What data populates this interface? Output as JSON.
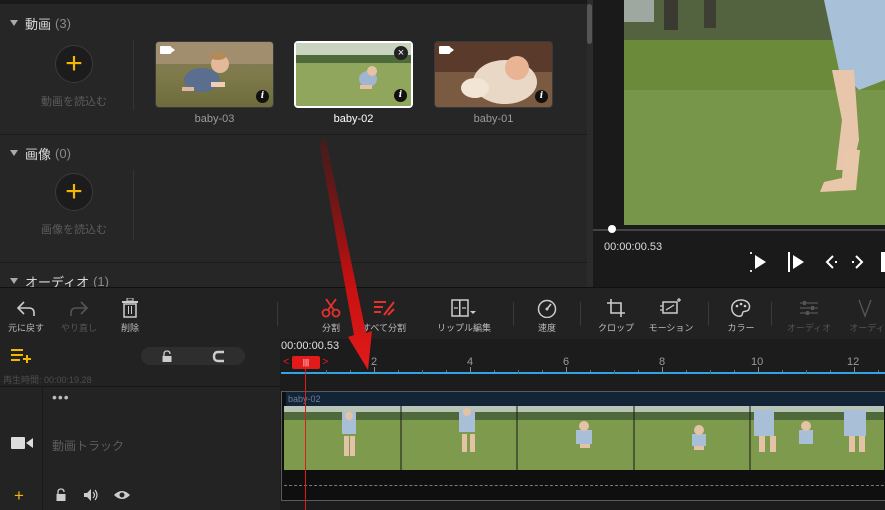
{
  "library": {
    "video_section": {
      "title": "動画",
      "count": "(3)",
      "import_label": "動画を読込む"
    },
    "image_section": {
      "title": "画像",
      "count": "(0)",
      "import_label": "画像を読込む"
    },
    "audio_section": {
      "title": "オーディオ",
      "count": "(1)"
    },
    "clips": [
      {
        "name": "baby-03",
        "selected": false
      },
      {
        "name": "baby-02",
        "selected": true
      },
      {
        "name": "baby-01",
        "selected": false
      }
    ]
  },
  "preview": {
    "time": "00:00:00.53",
    "progress": 0.06
  },
  "toolbar": {
    "undo": "元に戻す",
    "redo": "やり直し",
    "delete": "削除",
    "split": "分割",
    "split_all": "すべて分割",
    "ripple_edit": "リップル編集",
    "speed": "速度",
    "crop": "クロップ",
    "motion": "モーション",
    "color": "カラー",
    "audio": "オーディオ",
    "audio2": "オーディ"
  },
  "timeline": {
    "duration_label": "再生時間:",
    "duration": "00:00:19.28",
    "current_time": "00:00:00.53",
    "playhead_tag": "|||",
    "ruler_labels": [
      "2",
      "4",
      "6",
      "8",
      "10",
      "12"
    ],
    "track_more": "•••",
    "track_name": "動画トラック",
    "clip_name": "baby-02"
  },
  "colors": {
    "accent": "#f5b800",
    "playhead": "#e31a1a",
    "ruler": "#2fa4e7",
    "scissors": "#e8302d"
  }
}
